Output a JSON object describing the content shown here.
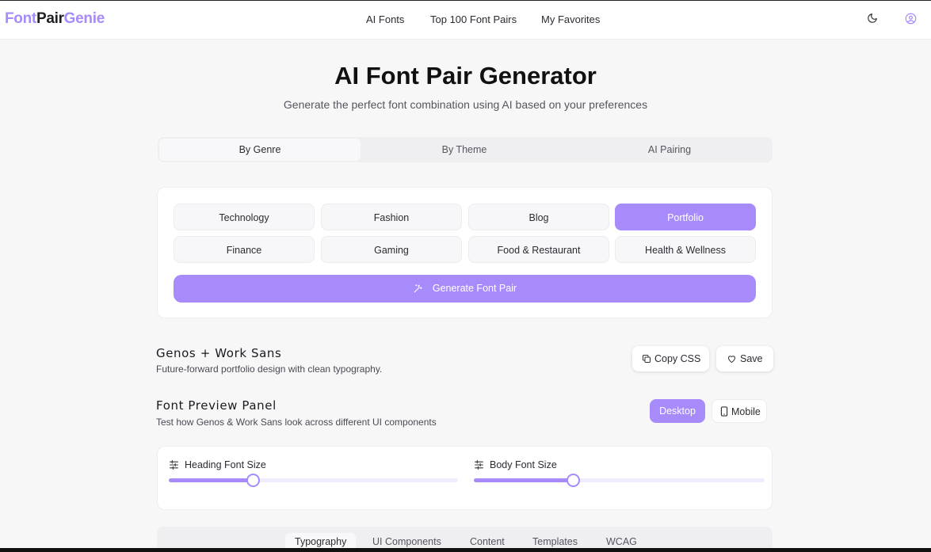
{
  "header": {
    "logo": {
      "part1": "Font",
      "part2": "Pair",
      "part3": "Genie"
    },
    "nav": [
      "AI Fonts",
      "Top 100 Font Pairs",
      "My Favorites"
    ],
    "icons": [
      "moon-icon",
      "user-circle-icon"
    ]
  },
  "hero": {
    "title": "AI Font Pair Generator",
    "subtitle": "Generate the perfect font combination using AI based on your preferences"
  },
  "mode_tabs": [
    "By Genre",
    "By Theme",
    "AI Pairing"
  ],
  "active_mode_tab": "By Genre",
  "genres": [
    "Technology",
    "Fashion",
    "Blog",
    "Portfolio",
    "Finance",
    "Gaming",
    "Food & Restaurant",
    "Health & Wellness"
  ],
  "active_genre": "Portfolio",
  "generate_label": "Generate Font Pair",
  "pair": {
    "name": "Genos + Work Sans",
    "description": "Future-forward portfolio design with clean typography.",
    "copy_label": "Copy CSS",
    "save_label": "Save"
  },
  "preview": {
    "title": "Font Preview Panel",
    "description": "Test how Genos & Work Sans look across different UI components",
    "desktop_label": "Desktop",
    "mobile_label": "Mobile"
  },
  "sliders": {
    "heading": {
      "label": "Heading Font Size",
      "level": 0.29
    },
    "body": {
      "label": "Body Font Size",
      "level": 0.34
    }
  },
  "content_tabs": [
    "Typography",
    "UI Components",
    "Content",
    "Templates",
    "WCAG"
  ],
  "active_content_tab": "Typography",
  "colors": {
    "accent": "#a78bfa",
    "background": "#f7f7f8"
  }
}
